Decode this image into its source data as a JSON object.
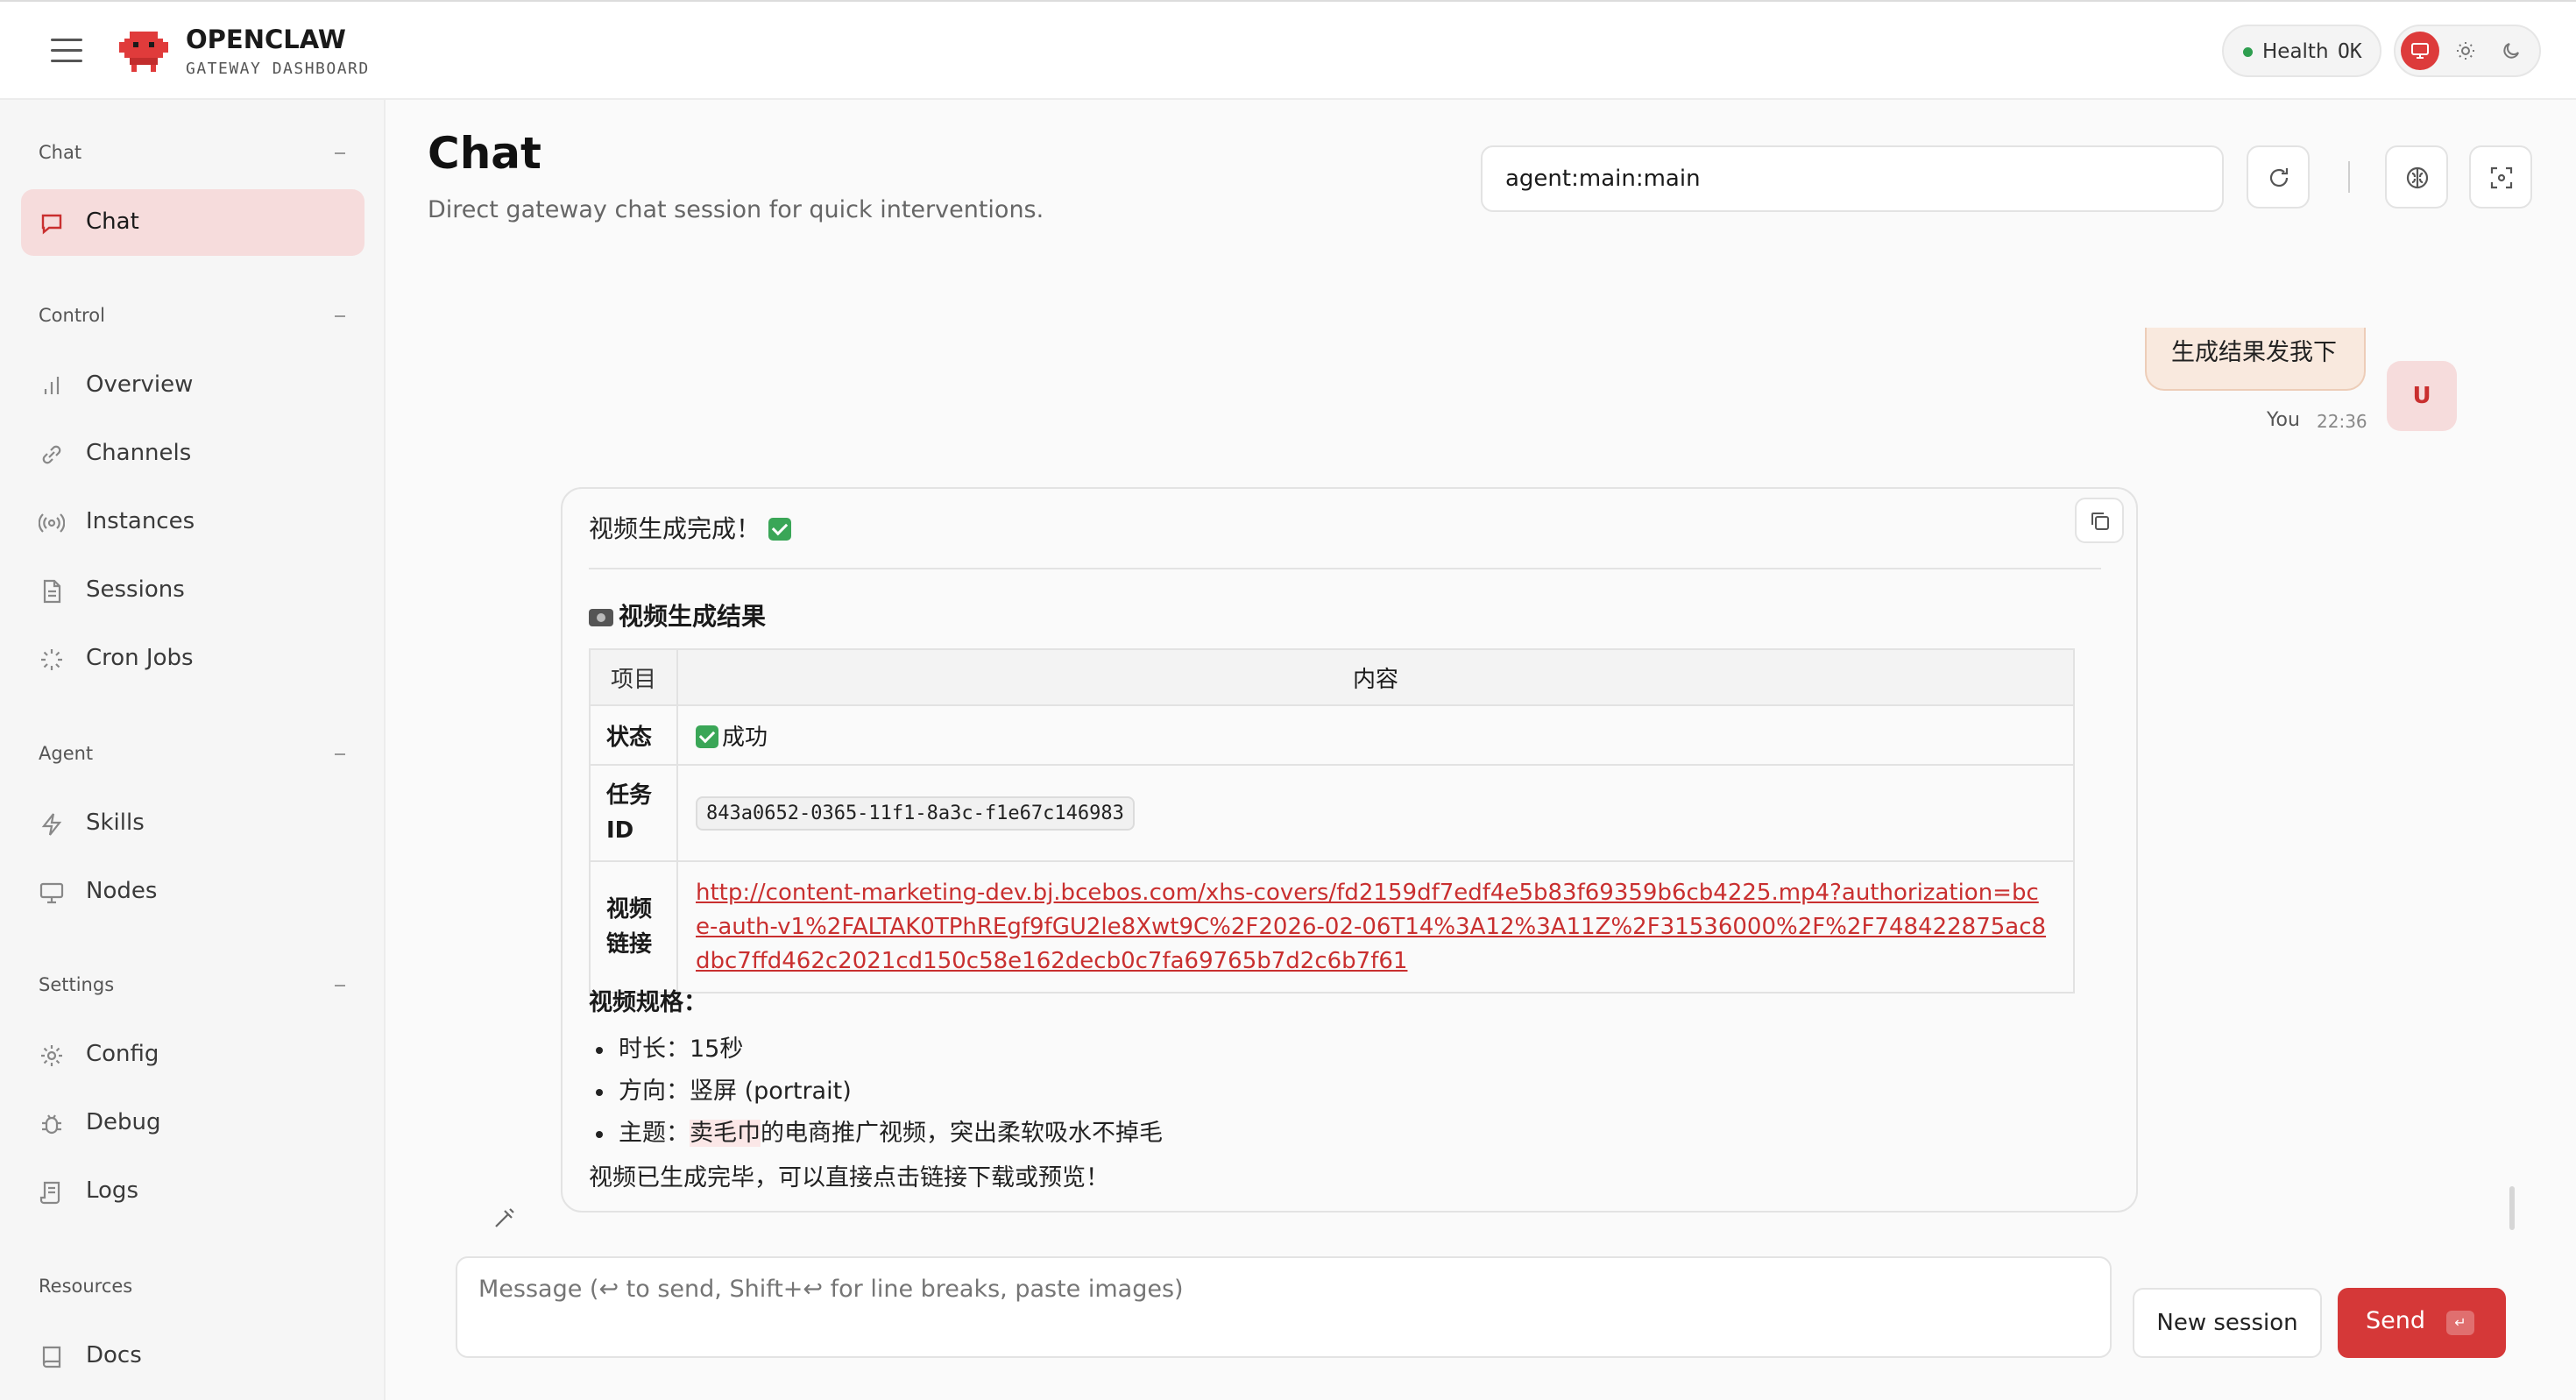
{
  "app": {
    "brand_title": "OPENCLAW",
    "brand_subtitle": "GATEWAY DASHBOARD",
    "health_label": "Health",
    "health_value": "OK"
  },
  "sidebar": {
    "sections": [
      {
        "label": "Chat",
        "items": [
          {
            "label": "Chat",
            "icon": "chat-bubble-icon",
            "active": true
          }
        ]
      },
      {
        "label": "Control",
        "items": [
          {
            "label": "Overview",
            "icon": "bar-chart-icon"
          },
          {
            "label": "Channels",
            "icon": "link-icon"
          },
          {
            "label": "Instances",
            "icon": "radio-icon"
          },
          {
            "label": "Sessions",
            "icon": "document-icon"
          },
          {
            "label": "Cron Jobs",
            "icon": "loader-icon"
          }
        ]
      },
      {
        "label": "Agent",
        "items": [
          {
            "label": "Skills",
            "icon": "lightning-icon"
          },
          {
            "label": "Nodes",
            "icon": "monitor-icon"
          }
        ]
      },
      {
        "label": "Settings",
        "items": [
          {
            "label": "Config",
            "icon": "gear-icon"
          },
          {
            "label": "Debug",
            "icon": "bug-icon"
          },
          {
            "label": "Logs",
            "icon": "scroll-icon"
          }
        ]
      },
      {
        "label": "Resources",
        "items": [
          {
            "label": "Docs",
            "icon": "book-icon"
          }
        ]
      }
    ]
  },
  "main": {
    "title": "Chat",
    "subtitle": "Direct gateway chat session for quick interventions.",
    "session_value": "agent:main:main"
  },
  "messages": {
    "user": {
      "text": "生成结果发我下",
      "sender": "You",
      "time": "22:36",
      "avatar": "U"
    },
    "assistant": {
      "intro": "视频生成完成！",
      "heading": "视频生成结果",
      "table": {
        "headers": [
          "项目",
          "内容"
        ],
        "rows": [
          {
            "key": "状态",
            "value": "成功"
          },
          {
            "key": "任务ID",
            "value": "843a0652-0365-11f1-8a3c-f1e67c146983"
          },
          {
            "key": "视频链接",
            "value": "http://content-marketing-dev.bj.bcebos.com/xhs-covers/fd2159df7edf4e5b83f69359b6cb4225.mp4?authorization=bce-auth-v1%2FALTAK0TPhREgf9fGU2le8Xwt9C%2F2026-02-06T14%3A12%3A11Z%2F31536000%2F%2F748422875ac8dbc7ffd462c2021cd150c58e162decb0c7fa69765b7d2c6b7f61"
          }
        ]
      },
      "spec_heading": "视频规格：",
      "specs": [
        {
          "prefix": "时长：",
          "highlight": "",
          "rest": "15秒"
        },
        {
          "prefix": "方向：",
          "highlight": "",
          "rest": "竖屏 (portrait)"
        },
        {
          "prefix": "主题：",
          "highlight": "卖毛巾",
          "rest": "的电商推广视频，突出柔软吸水不掉毛"
        }
      ],
      "outro": "视频已生成完毕，可以直接点击链接下载或预览！"
    }
  },
  "composer": {
    "placeholder": "Message (↩ to send, Shift+↩ for line breaks, paste images)",
    "new_session_label": "New session",
    "send_label": "Send",
    "send_kbd": "↵"
  },
  "colors": {
    "accent": "#d53838",
    "active_nav_bg": "#f6dcdc",
    "health_dot": "#2e9e4f",
    "user_bubble_bg": "#f9e9de"
  }
}
